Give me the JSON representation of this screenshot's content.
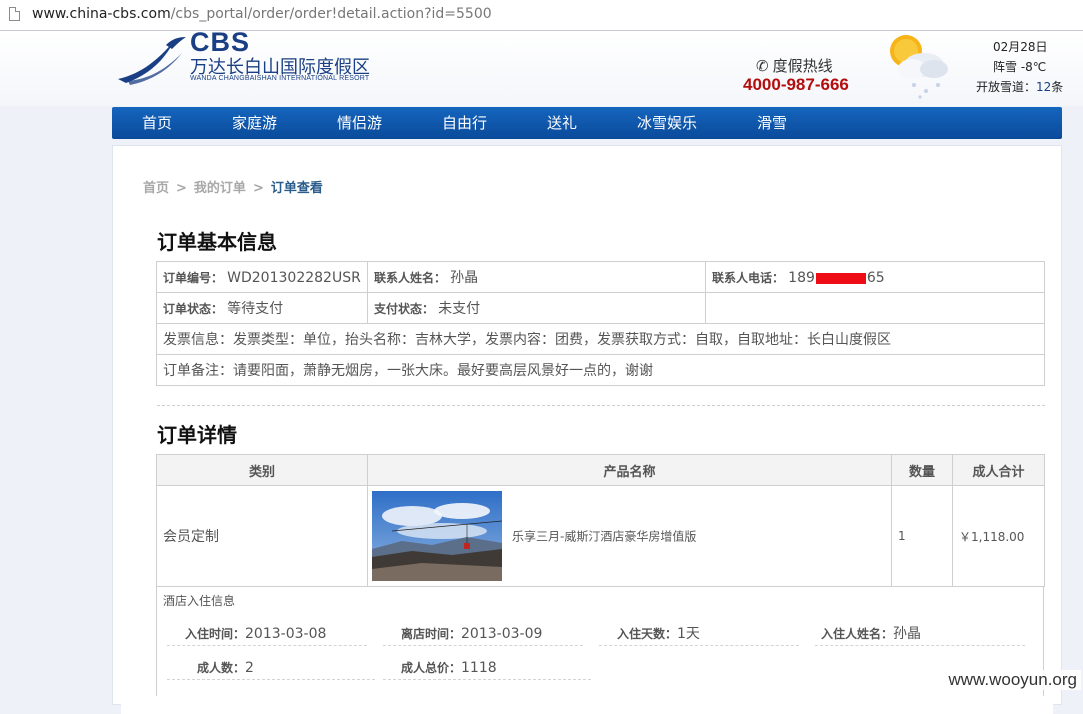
{
  "browser": {
    "url_host": "www.china-cbs.com",
    "url_rest": "/cbs_portal/order/order!detail.action?id=5500"
  },
  "header": {
    "logo_title": "CBS",
    "logo_cn": "万达长白山国际度假区",
    "logo_en": "WANDA CHANGBAISHAN INTERNATIONAL RESORT",
    "hotline_label": "度假热线",
    "hotline_number": "4000-987-666",
    "weather_date": "02月28日",
    "weather_temp": "阵雪 -8℃",
    "slopes_label": "开放雪道：",
    "slopes_count": "12",
    "slopes_unit": "条"
  },
  "nav": {
    "items": [
      "首页",
      "家庭游",
      "情侣游",
      "自由行",
      "送礼",
      "冰雪娱乐",
      "滑雪"
    ]
  },
  "breadcrumb": {
    "home": "首页",
    "sep": ">",
    "orders": "我的订单",
    "current": "订单查看"
  },
  "basic_info": {
    "title": "订单基本信息",
    "order_no_label": "订单编号：",
    "order_no": "WD201302282USR",
    "contact_name_label": "联系人姓名：",
    "contact_name": "孙晶",
    "contact_phone_label": "联系人电话：",
    "contact_phone_prefix": "189",
    "contact_phone_suffix": "65",
    "order_status_label": "订单状态：",
    "order_status": "等待支付",
    "pay_status_label": "支付状态：",
    "pay_status": "未支付",
    "invoice": "发票信息：发票类型：单位，抬头名称：吉林大学，发票内容：团费，发票获取方式：自取，自取地址：长白山度假区",
    "remark": "订单备注：请要阳面，萧静无烟房，一张大床。最好要高层风景好一点的，谢谢"
  },
  "detail": {
    "title": "订单详情",
    "columns": [
      "类别",
      "产品名称",
      "数量",
      "成人合计"
    ],
    "rows": [
      {
        "category": "会员定制",
        "product": "乐享三月-威斯汀酒店豪华房增值版",
        "quantity": "1",
        "total": "￥1,118.00"
      }
    ]
  },
  "hotel": {
    "title": "酒店入住信息",
    "checkin_label": "入住时间：",
    "checkin": "2013-03-08",
    "checkout_label": "离店时间：",
    "checkout": "2013-03-09",
    "days_label": "入住天数：",
    "days": "1天",
    "guest_label": "入住人姓名：",
    "guest": "孙晶",
    "adults_label": "成人数：",
    "adults": "2",
    "adult_total_label": "成人总价：",
    "adult_total": "1118"
  },
  "watermark": "www.wooyun.org",
  "colors": {
    "brand": "#1a3f84",
    "nav": "#0f58ae",
    "hotline": "#b40d0d",
    "redaction": "#ee0d17"
  }
}
